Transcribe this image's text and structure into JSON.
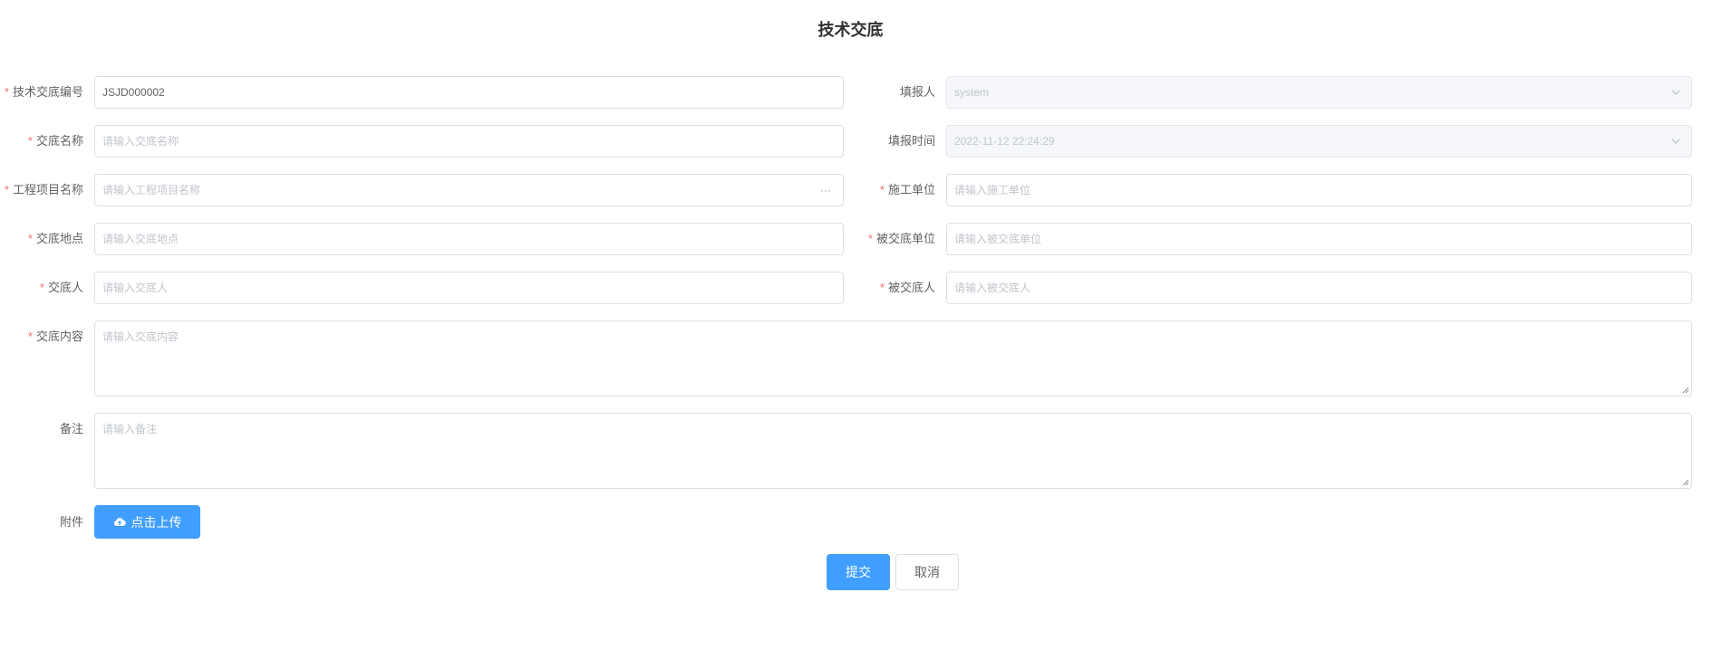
{
  "page": {
    "title": "技术交底"
  },
  "form": {
    "code": {
      "label": "技术交底编号",
      "value": "JSJD000002",
      "required": true
    },
    "reporter": {
      "label": "填报人",
      "value": "system",
      "required": false
    },
    "name": {
      "label": "交底名称",
      "placeholder": "请输入交底名称",
      "required": true
    },
    "report_time": {
      "label": "填报时间",
      "value": "2022-11-12 22:24:29",
      "required": false
    },
    "project": {
      "label": "工程项目名称",
      "placeholder": "请输入工程项目名称",
      "suffix": "···",
      "required": true
    },
    "construction_unit": {
      "label": "施工单位",
      "placeholder": "请输入施工单位",
      "required": true
    },
    "location": {
      "label": "交底地点",
      "placeholder": "请输入交底地点",
      "required": true
    },
    "recipient_unit": {
      "label": "被交底单位",
      "placeholder": "请输入被交底单位",
      "required": true
    },
    "presenter": {
      "label": "交底人",
      "placeholder": "请输入交底人",
      "required": true
    },
    "recipient": {
      "label": "被交底人",
      "placeholder": "请输入被交底人",
      "required": true
    },
    "content": {
      "label": "交底内容",
      "placeholder": "请输入交底内容",
      "required": true
    },
    "remark": {
      "label": "备注",
      "placeholder": "请输入备注",
      "required": false
    },
    "attachment": {
      "label": "附件",
      "button_label": "点击上传"
    }
  },
  "actions": {
    "submit_label": "提交",
    "cancel_label": "取消"
  },
  "icons": {
    "select_arrow": "chevron-down-icon",
    "upload": "cloud-upload-icon",
    "more": "ellipsis-icon"
  },
  "colors": {
    "primary": "#409eff",
    "required": "#f56c6c"
  }
}
